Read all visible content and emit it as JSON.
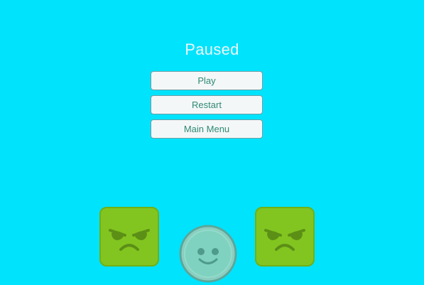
{
  "pause_menu": {
    "title": "Paused",
    "buttons": {
      "play": "Play",
      "restart": "Restart",
      "main_menu": "Main Menu"
    }
  },
  "characters": {
    "left_enemy": "angry-green-block",
    "player": "smiling-green-ball",
    "right_enemy": "angry-green-block"
  },
  "colors": {
    "background": "#00e3fd",
    "title_text": "#eef8f9",
    "button_text": "#2f8a72",
    "enemy_fill": "#82c520",
    "player_fill": "#7fd2bf"
  }
}
